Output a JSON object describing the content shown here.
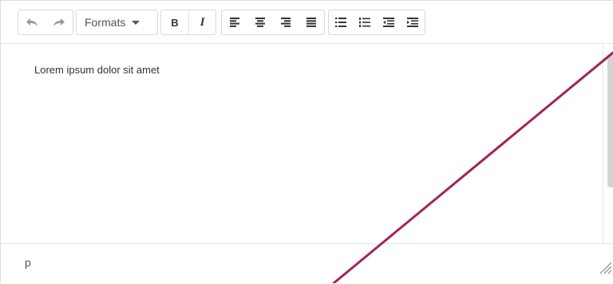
{
  "toolbar": {
    "formats_label": "Formats",
    "bold_label": "B",
    "italic_label": "I"
  },
  "content": {
    "paragraph_text": "Lorem ipsum dolor sit amet"
  },
  "statusbar": {
    "element_path": "p"
  },
  "icons": [
    "undo-icon",
    "redo-icon",
    "chevron-down-icon",
    "align-left-icon",
    "align-center-icon",
    "align-right-icon",
    "align-justify-icon",
    "bullet-list-icon",
    "numbered-list-icon",
    "outdent-icon",
    "indent-icon",
    "resize-handle-icon"
  ],
  "colors": {
    "annotation_line": "#a0255a",
    "border": "#dcdcdc",
    "text": "#333333"
  }
}
